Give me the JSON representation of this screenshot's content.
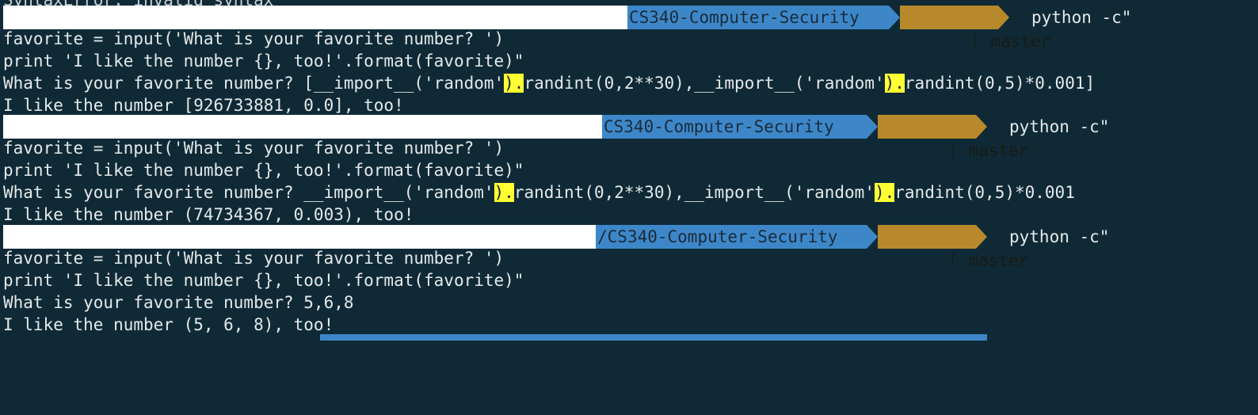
{
  "terminal": {
    "top_cut_text": "SyntaxError: invalid syntax",
    "prompt": {
      "path": "CS340-Computer-Security",
      "branch_icon": "git-branch-icon",
      "branch": "master",
      "command": "python -c\""
    },
    "blocks": [
      {
        "code_line_1": "favorite = input('What is your favorite number? ')",
        "code_line_2": "print 'I like the number {}, too!'.format(favorite)\"",
        "input_parts": [
          "What is your favorite number? [__import__('random'",
          ").",
          "randint(0,2**30),__import__('random'",
          ").",
          "randint(0,5)*0.001]"
        ],
        "output": "I like the number [926733881, 0.0], too!"
      },
      {
        "code_line_1": "favorite = input('What is your favorite number? ')",
        "code_line_2": "print 'I like the number {}, too!'.format(favorite)\"",
        "input_parts": [
          "What is your favorite number? __import__('random'",
          ").",
          "randint(0,2**30),__import__('random'",
          ").",
          "randint(0,5)*0.001"
        ],
        "output": "I like the number (74734367, 0.003), too!"
      },
      {
        "code_line_1": "favorite = input('What is your favorite number? ')",
        "code_line_2": "print 'I like the number {}, too!'.format(favorite)\"",
        "input_parts": [
          "What is your favorite number? 5,6,8"
        ],
        "output": "I like the number (5, 6, 8), too!"
      }
    ]
  },
  "colors": {
    "background": "#0f2a36",
    "path_segment": "#3d87c9",
    "branch_segment": "#b8892b",
    "highlight": "#ffff33"
  }
}
